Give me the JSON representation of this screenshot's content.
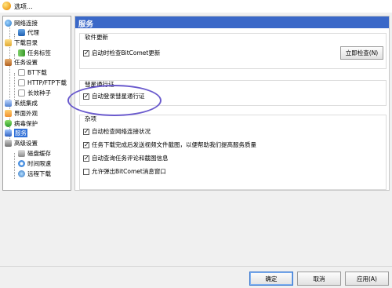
{
  "window": {
    "title": "选项..."
  },
  "sidebar": {
    "items": [
      {
        "label": "网络连接",
        "icon": "globe-icon"
      },
      {
        "label": "代理",
        "icon": "proxy-icon"
      },
      {
        "label": "下载目录",
        "icon": "folder-icon"
      },
      {
        "label": "任务标签",
        "icon": "tag-icon"
      },
      {
        "label": "任务设置",
        "icon": "task-settings-icon"
      },
      {
        "label": "BT下载",
        "icon": "document-icon"
      },
      {
        "label": "HTTP/FTP下载",
        "icon": "document-icon"
      },
      {
        "label": "长效种子",
        "icon": "document-icon"
      },
      {
        "label": "系统集成",
        "icon": "integration-icon"
      },
      {
        "label": "界面外观",
        "icon": "appearance-icon"
      },
      {
        "label": "病毒保护",
        "icon": "shield-icon"
      },
      {
        "label": "服务",
        "icon": "service-icon",
        "selected": true
      },
      {
        "label": "高级设置",
        "icon": "advanced-icon"
      },
      {
        "label": "磁盘缓存",
        "icon": "disk-icon"
      },
      {
        "label": "时间限速",
        "icon": "speed-limit-icon"
      },
      {
        "label": "远程下载",
        "icon": "remote-icon"
      }
    ]
  },
  "main": {
    "header": "服务",
    "software_update": {
      "title": "软件更新",
      "check_on_start": {
        "label": "启动时检查BitComet更新",
        "checked": true
      },
      "check_now_button": "立即检查(N)"
    },
    "comet_pass": {
      "title": "彗星通行证",
      "auto_login": {
        "label": "自动登录彗星通行证",
        "checked": true
      }
    },
    "misc": {
      "title": "杂项",
      "options": [
        {
          "label": "自动检查网络连接状况",
          "checked": true
        },
        {
          "label": "任务下载完成后发送视频文件截图，以便帮助我们提高服务质量",
          "checked": true
        },
        {
          "label": "自动查询任务评论和截图信息",
          "checked": true
        },
        {
          "label": "允许弹出BitComet消息窗口",
          "checked": false
        }
      ]
    }
  },
  "footer": {
    "ok_button": "确定",
    "cancel_button": "取消",
    "apply_button": "应用(A)"
  },
  "colors": {
    "header_bg": "#3a68c8",
    "selection_bg": "#3070d8",
    "annotation_oval": "#6a5acd"
  }
}
